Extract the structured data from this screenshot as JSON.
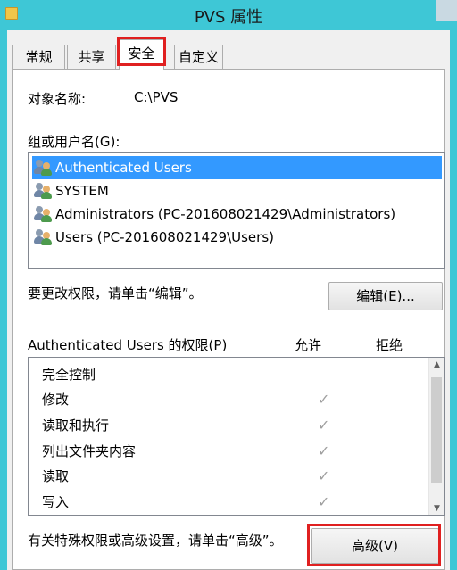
{
  "window": {
    "title": "PVS 属性"
  },
  "tabs": [
    {
      "label": "常规",
      "active": false
    },
    {
      "label": "共享",
      "active": false
    },
    {
      "label": "安全",
      "active": true
    },
    {
      "label": "自定义",
      "active": false
    }
  ],
  "object": {
    "label": "对象名称:",
    "value": "C:\\PVS"
  },
  "groups": {
    "label": "组或用户名(G):",
    "items": [
      {
        "name": "Authenticated Users",
        "selected": true,
        "icon": "user-group-icon"
      },
      {
        "name": "SYSTEM",
        "selected": false,
        "icon": "user-group-icon"
      },
      {
        "name": "Administrators (PC-201608021429\\Administrators)",
        "selected": false,
        "icon": "user-group-icon"
      },
      {
        "name": "Users (PC-201608021429\\Users)",
        "selected": false,
        "icon": "user-group-icon"
      }
    ]
  },
  "edit": {
    "hint": "要更改权限，请单击“编辑”。",
    "button": "编辑(E)..."
  },
  "permissions": {
    "header": "Authenticated Users 的权限(P)",
    "allow_header": "允许",
    "deny_header": "拒绝",
    "rows": [
      {
        "name": "完全控制",
        "allow": false,
        "deny": false
      },
      {
        "name": "修改",
        "allow": true,
        "deny": false
      },
      {
        "name": "读取和执行",
        "allow": true,
        "deny": false
      },
      {
        "name": "列出文件夹内容",
        "allow": true,
        "deny": false
      },
      {
        "name": "读取",
        "allow": true,
        "deny": false
      },
      {
        "name": "写入",
        "allow": true,
        "deny": false
      }
    ],
    "check_glyph": "✓"
  },
  "advanced": {
    "hint": "有关特殊权限或高级设置，请单击“高级”。",
    "button": "高级(V)"
  },
  "colors": {
    "titlebar": "#3ec7d6",
    "selection": "#3399ff",
    "highlight": "#e02020"
  }
}
